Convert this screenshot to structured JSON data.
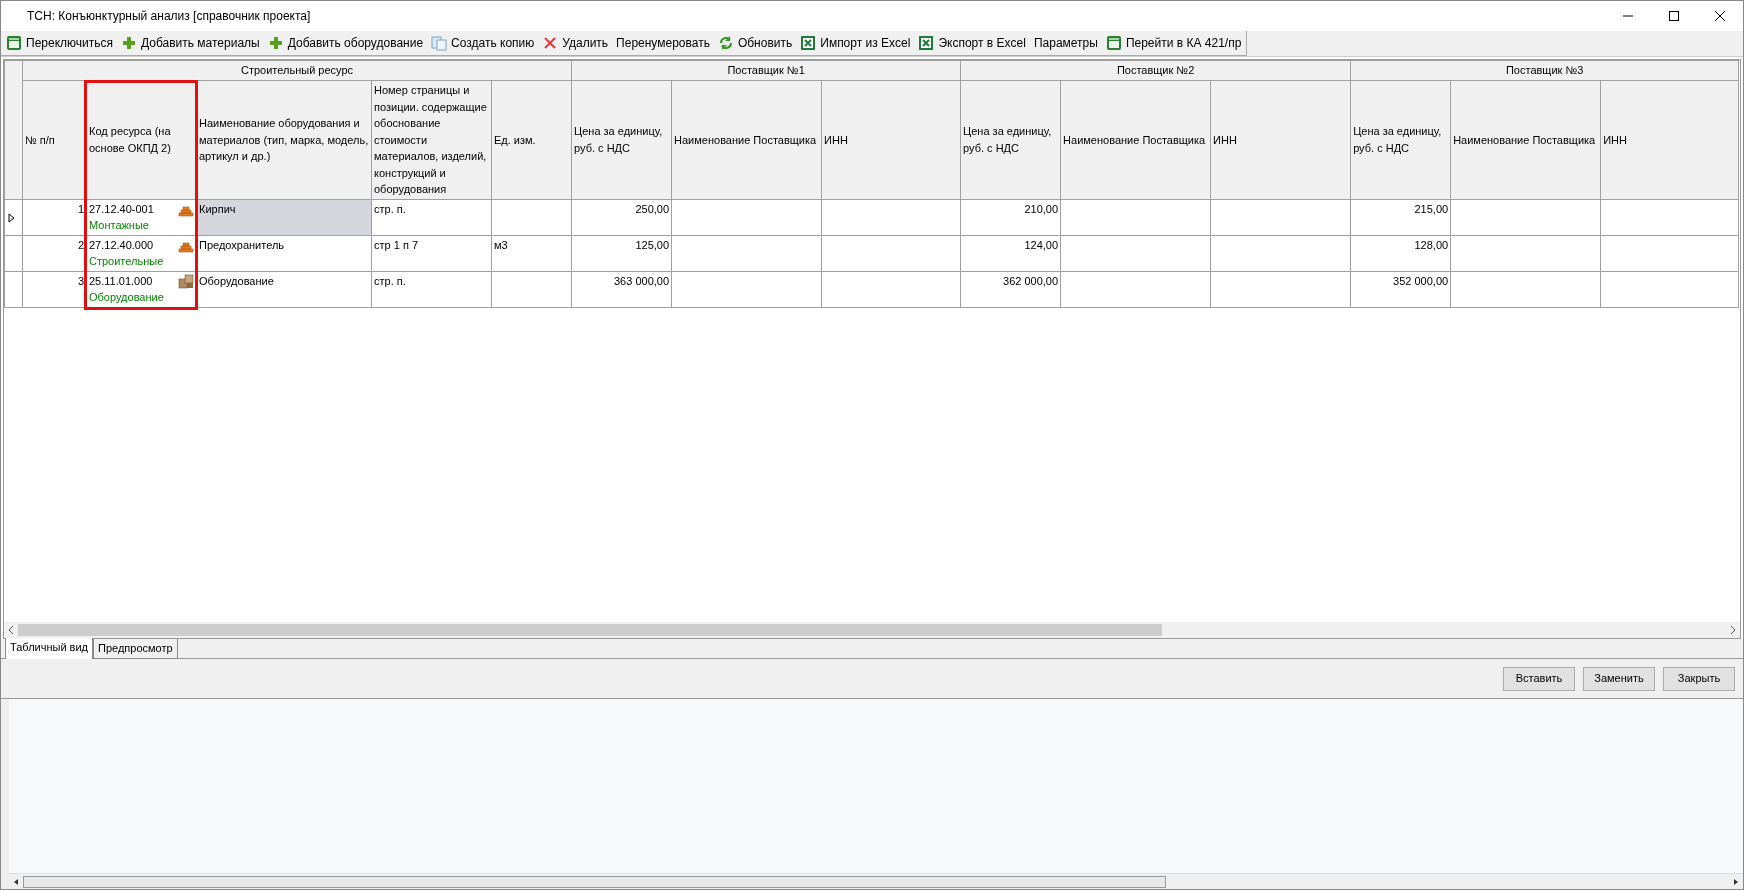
{
  "window": {
    "title": "ТСН: Конъюнктурный анализ [справочник проекта]"
  },
  "toolbar": [
    {
      "label": "Переключиться",
      "kind": "ka"
    },
    {
      "label": "Добавить материалы",
      "kind": "plus"
    },
    {
      "label": "Добавить оборудование",
      "kind": "plus"
    },
    {
      "label": "Создать копию",
      "kind": "copy"
    },
    {
      "label": "Удалить",
      "kind": "delete"
    },
    {
      "label": "Перенумеровать",
      "kind": "text"
    },
    {
      "label": "Обновить",
      "kind": "refresh"
    },
    {
      "label": "Импорт из Excel",
      "kind": "excel"
    },
    {
      "label": "Экспорт в Excel",
      "kind": "excel"
    },
    {
      "label": "Параметры",
      "kind": "text"
    },
    {
      "label": "Перейти в КА 421/пр",
      "kind": "ka"
    }
  ],
  "table": {
    "groups": [
      {
        "label": "Строительный ресурс"
      },
      {
        "label": "Поставщик №1"
      },
      {
        "label": "Поставщик №2"
      },
      {
        "label": "Поставщик №3"
      }
    ],
    "columns": [
      {
        "label": "№ п/п",
        "highlighted": false
      },
      {
        "label": "Код ресурса (на основе ОКПД 2)",
        "highlighted": true
      },
      {
        "label": "Наименование оборудования и материалов (тип, марка, модель, артикул и др.)",
        "highlighted": false
      },
      {
        "label": "Номер страницы и позиции. содержащие обоснование стоимости материалов, изделий, конструкций и оборудования",
        "highlighted": false
      },
      {
        "label": "Ед. изм.",
        "highlighted": false
      },
      {
        "label": "Цена за единицу, руб. с НДС",
        "highlighted": false
      },
      {
        "label": "Наименование Поставщика",
        "highlighted": false
      },
      {
        "label": "ИНН",
        "highlighted": false
      },
      {
        "label": "Цена за единицу, руб. с НДС",
        "highlighted": false
      },
      {
        "label": "Наименование Поставщика",
        "highlighted": false
      },
      {
        "label": "ИНН",
        "highlighted": false
      },
      {
        "label": "Цена за единицу, руб. с НДС",
        "highlighted": false
      },
      {
        "label": "Наименование Поставщика",
        "highlighted": false
      },
      {
        "label": "ИНН",
        "highlighted": false
      }
    ],
    "rows": [
      {
        "selected": true,
        "number": "1",
        "code": "27.12.40-001",
        "category": "Монтажные",
        "kind": "material",
        "name": "Кирпич",
        "page": "стр. п.",
        "unit": "",
        "prices": [
          "250,00",
          "210,00",
          "215,00"
        ]
      },
      {
        "selected": false,
        "number": "2",
        "code": "27.12.40.000",
        "category": "Строительные",
        "kind": "material",
        "name": "Предохранитель",
        "page": "стр 1 п 7",
        "unit": "м3",
        "prices": [
          "125,00",
          "124,00",
          "128,00"
        ]
      },
      {
        "selected": false,
        "number": "3",
        "code": "25.11.01.000",
        "category": "Оборудование",
        "kind": "equipment",
        "name": "Оборудование",
        "page": "стр. п.",
        "unit": "",
        "prices": [
          "363 000,00",
          "362 000,00",
          "352 000,00"
        ]
      }
    ]
  },
  "tabs": [
    {
      "label": "Табличный вид",
      "selected": true
    },
    {
      "label": "Предпросмотр",
      "selected": false
    }
  ],
  "buttons": [
    "Вставить",
    "Заменить",
    "Закрыть"
  ]
}
